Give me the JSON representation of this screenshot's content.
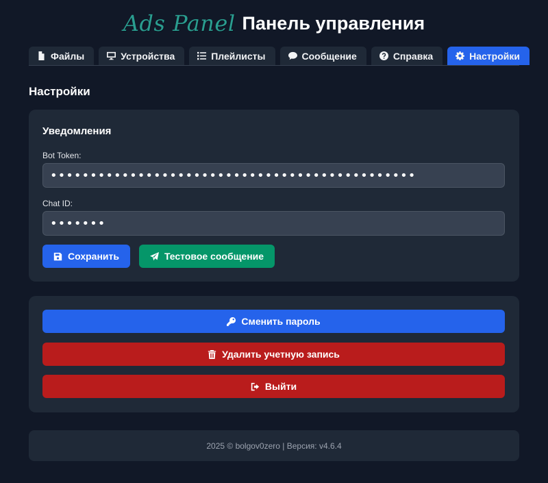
{
  "header": {
    "logo": "Ads Panel",
    "title": "Панель управления"
  },
  "tabs": [
    {
      "label": "Файлы",
      "icon": "file-icon"
    },
    {
      "label": "Устройства",
      "icon": "monitor-icon"
    },
    {
      "label": "Плейлисты",
      "icon": "list-icon"
    },
    {
      "label": "Сообщение",
      "icon": "comment-icon"
    },
    {
      "label": "Справка",
      "icon": "question-icon"
    },
    {
      "label": "Настройки",
      "icon": "gear-icon",
      "active": true
    }
  ],
  "page": {
    "title": "Настройки"
  },
  "notifications": {
    "title": "Уведомления",
    "bot_token_label": "Bot Token:",
    "bot_token_value": "••••••••••••••••••••••••••••••••••••••••••••••",
    "chat_id_label": "Chat ID:",
    "chat_id_value": "•••••••",
    "save_label": "Сохранить",
    "test_label": "Тестовое сообщение"
  },
  "account": {
    "change_password_label": "Сменить пароль",
    "delete_label": "Удалить учетную запись",
    "logout_label": "Выйти"
  },
  "footer": {
    "text": "2025 © bolgov0zero | Версия: v4.6.4"
  },
  "colors": {
    "background": "#111827",
    "card": "#1f2937",
    "primary": "#2563eb",
    "success": "#059669",
    "danger": "#b91c1c",
    "logo": "#2a9d8f"
  }
}
